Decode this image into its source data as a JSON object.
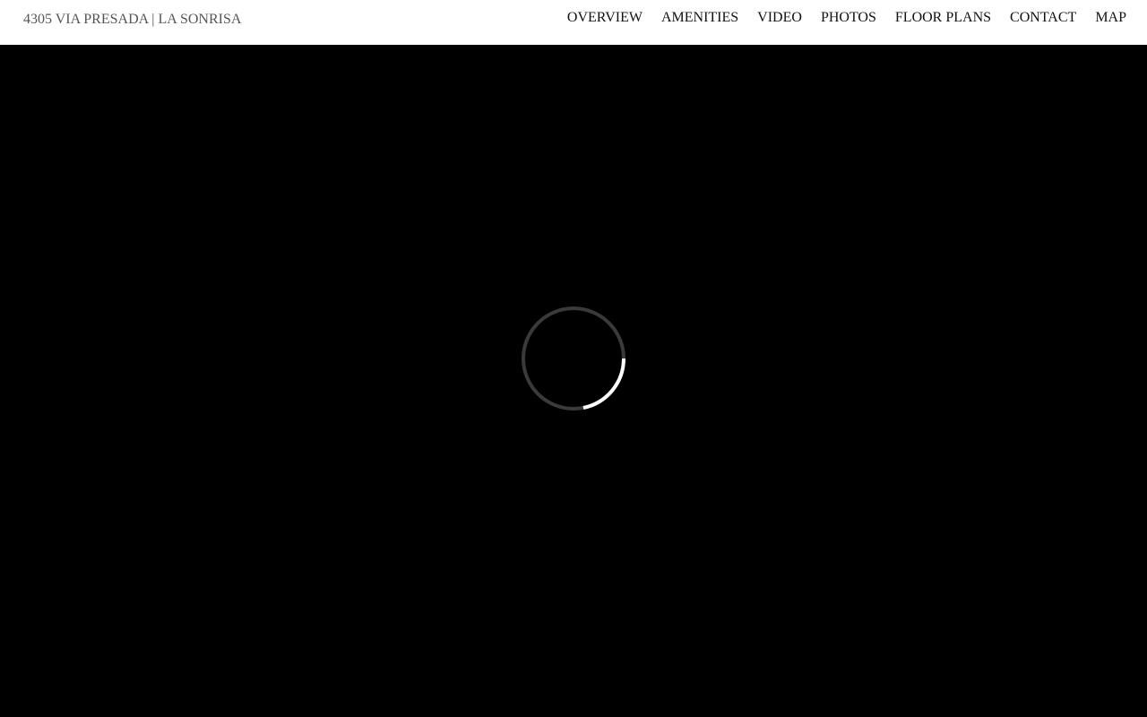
{
  "header": {
    "title": "4305 VIA PRESADA | LA SONRISA",
    "background": "#ffffff",
    "title_color": "#555555"
  },
  "nav": {
    "items": [
      {
        "label": "OVERVIEW"
      },
      {
        "label": "AMENITIES"
      },
      {
        "label": "VIDEO"
      },
      {
        "label": "PHOTOS"
      },
      {
        "label": "FLOOR PLANS"
      },
      {
        "label": "CONTACT"
      },
      {
        "label": "MAP"
      }
    ],
    "color": "#111111"
  },
  "stage": {
    "background": "#000000",
    "loader": {
      "icon": "loading-spinner-icon",
      "track_color": "#3a3a3a",
      "arc_color": "#ffffff"
    }
  }
}
